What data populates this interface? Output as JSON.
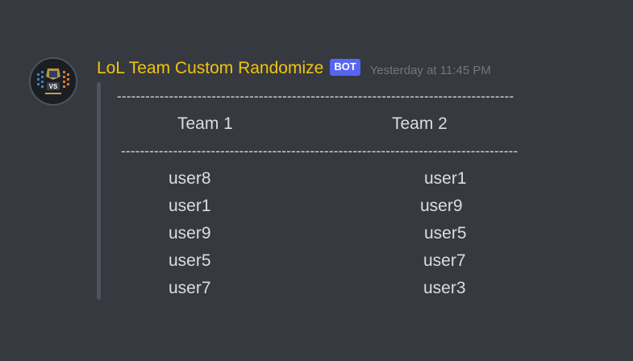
{
  "message": {
    "username": "LoL Team Custom Randomize",
    "bot_tag": "BOT",
    "timestamp": "Yesterday at 11:45 PM",
    "avatar_text": "VS"
  },
  "embed": {
    "divider": "------------------------------------------------------------------------------------",
    "team1_header": "Team 1",
    "team2_header": "Team 2",
    "team1": [
      "user8",
      "user1",
      "user9",
      "user5",
      "user7"
    ],
    "team2": [
      "user1",
      "user9",
      "user5",
      "user7",
      "user3"
    ]
  },
  "colors": {
    "background": "#36393f",
    "username": "#f1c40f",
    "bot_tag": "#5865f2",
    "timestamp": "#72767d",
    "embed_bar": "#4f545c",
    "text": "#dcddde"
  }
}
